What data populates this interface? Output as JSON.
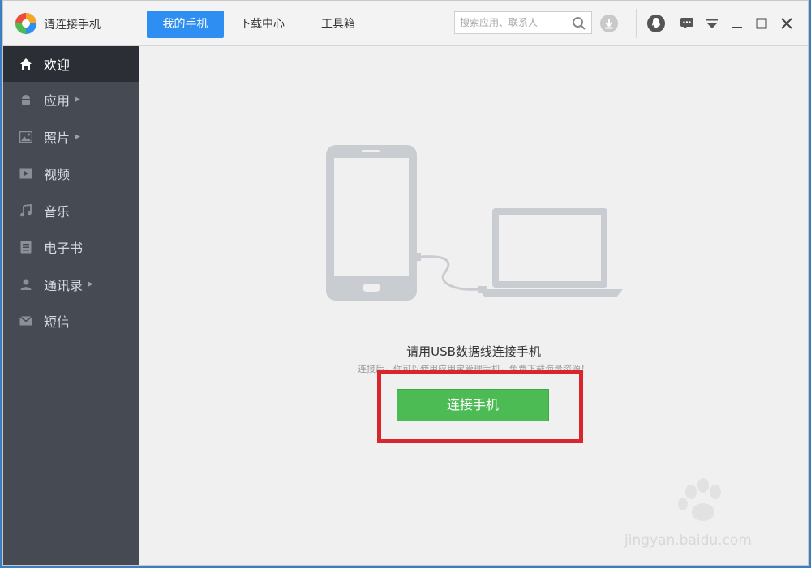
{
  "app": {
    "title": "请连接手机"
  },
  "nav": {
    "tabs": [
      {
        "label": "我的手机",
        "active": true
      },
      {
        "label": "下载中心",
        "active": false
      },
      {
        "label": "工具箱",
        "active": false
      }
    ]
  },
  "search": {
    "placeholder": "搜索应用、联系人"
  },
  "window_icons": [
    "download-icon",
    "qq-icon",
    "message-icon",
    "menu-icon",
    "minimize-icon",
    "maximize-icon",
    "close-icon"
  ],
  "sidebar": {
    "items": [
      {
        "label": "欢迎",
        "icon": "home-icon",
        "active": true,
        "has_arrow": false
      },
      {
        "label": "应用",
        "icon": "android-icon",
        "active": false,
        "has_arrow": true
      },
      {
        "label": "照片",
        "icon": "photo-icon",
        "active": false,
        "has_arrow": true
      },
      {
        "label": "视频",
        "icon": "video-icon",
        "active": false,
        "has_arrow": false
      },
      {
        "label": "音乐",
        "icon": "music-icon",
        "active": false,
        "has_arrow": false
      },
      {
        "label": "电子书",
        "icon": "ebook-icon",
        "active": false,
        "has_arrow": false
      },
      {
        "label": "通讯录",
        "icon": "contacts-icon",
        "active": false,
        "has_arrow": true
      },
      {
        "label": "短信",
        "icon": "sms-icon",
        "active": false,
        "has_arrow": false
      }
    ]
  },
  "main": {
    "headline": "请用USB数据线连接手机",
    "subline": "连接后，你可以使用应用宝管理手机，免费下载海量资源！",
    "connect_button": "连接手机"
  },
  "watermark": {
    "text": "jingyan.baidu.com"
  },
  "colors": {
    "accent": "#2f8ef2",
    "button_green": "#4dbb54",
    "highlight_red": "#d8262c",
    "sidebar_bg": "#454a53"
  }
}
